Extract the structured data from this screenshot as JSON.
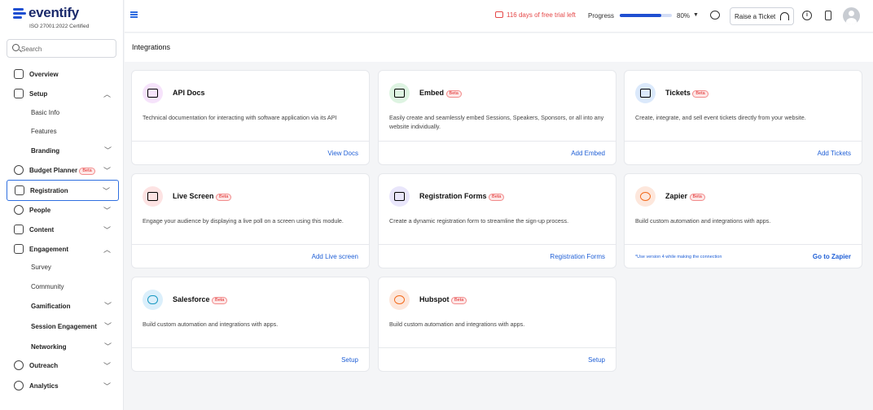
{
  "brand": {
    "name": "eventify",
    "certification": "ISO 27001:2022 Certified"
  },
  "search": {
    "placeholder": "Search"
  },
  "sidebar": {
    "beta_badge": "Beta",
    "overview": "Overview",
    "setup": "Setup",
    "basic_info": "Basic Info",
    "features": "Features",
    "branding": "Branding",
    "budget_planner": "Budget Planner",
    "registration": "Registration",
    "people": "People",
    "content": "Content",
    "engagement": "Engagement",
    "survey": "Survey",
    "community": "Community",
    "gamification": "Gamification",
    "session_engagement": "Session Engagement",
    "networking": "Networking",
    "outreach": "Outreach",
    "analytics": "Analytics"
  },
  "header": {
    "trial_text": "116 days of free trial left",
    "progress_label": "Progress",
    "progress_value": 80,
    "progress_text": "80%",
    "raise_ticket": "Raise a Ticket",
    "info_glyph": "i",
    "accent": "#1f4fd1"
  },
  "page": {
    "title": "Integrations"
  },
  "cards": [
    {
      "title": "API Docs",
      "desc": "Technical documentation for interacting with software application via its API",
      "action": "View Docs",
      "icon": "code-icon",
      "icon_bg": "#f6e3fb"
    },
    {
      "title": "Embed",
      "desc": "Easily create and seamlessly embed Sessions, Speakers, Sponsors, or all into any website individually.",
      "action": "Add Embed",
      "icon": "embed-icon",
      "icon_bg": "#def4e2"
    },
    {
      "title": "Tickets",
      "desc": "Create, integrate, and sell event tickets directly from your website.",
      "action": "Add Tickets",
      "icon": "ticket-icon",
      "icon_bg": "#dbe9fb"
    },
    {
      "title": "Live Screen",
      "desc": "Engage your audience by displaying a live poll on a screen using this module.",
      "action": "Add Live screen",
      "icon": "cast-icon",
      "icon_bg": "#fde3e3"
    },
    {
      "title": "Registration Forms",
      "desc": "Create a dynamic registration form to streamline the sign-up process.",
      "action": "Registration Forms",
      "icon": "form-icon",
      "icon_bg": "#e9e6fb"
    },
    {
      "title": "Zapier",
      "desc": "Build custom automation and integrations with apps.",
      "action": "Go to Zapier",
      "note": "*Use version 4 while making the connection",
      "icon": "zapier-icon",
      "icon_bg": "#fde7dc"
    },
    {
      "title": "Salesforce",
      "desc": "Build custom automation and integrations with apps.",
      "action": "Setup",
      "icon": "salesforce-icon",
      "icon_bg": "#dbeffb"
    },
    {
      "title": "Hubspot",
      "desc": "Build custom automation and integrations with apps.",
      "action": "Setup",
      "icon": "hubspot-icon",
      "icon_bg": "#fde7dc"
    }
  ]
}
